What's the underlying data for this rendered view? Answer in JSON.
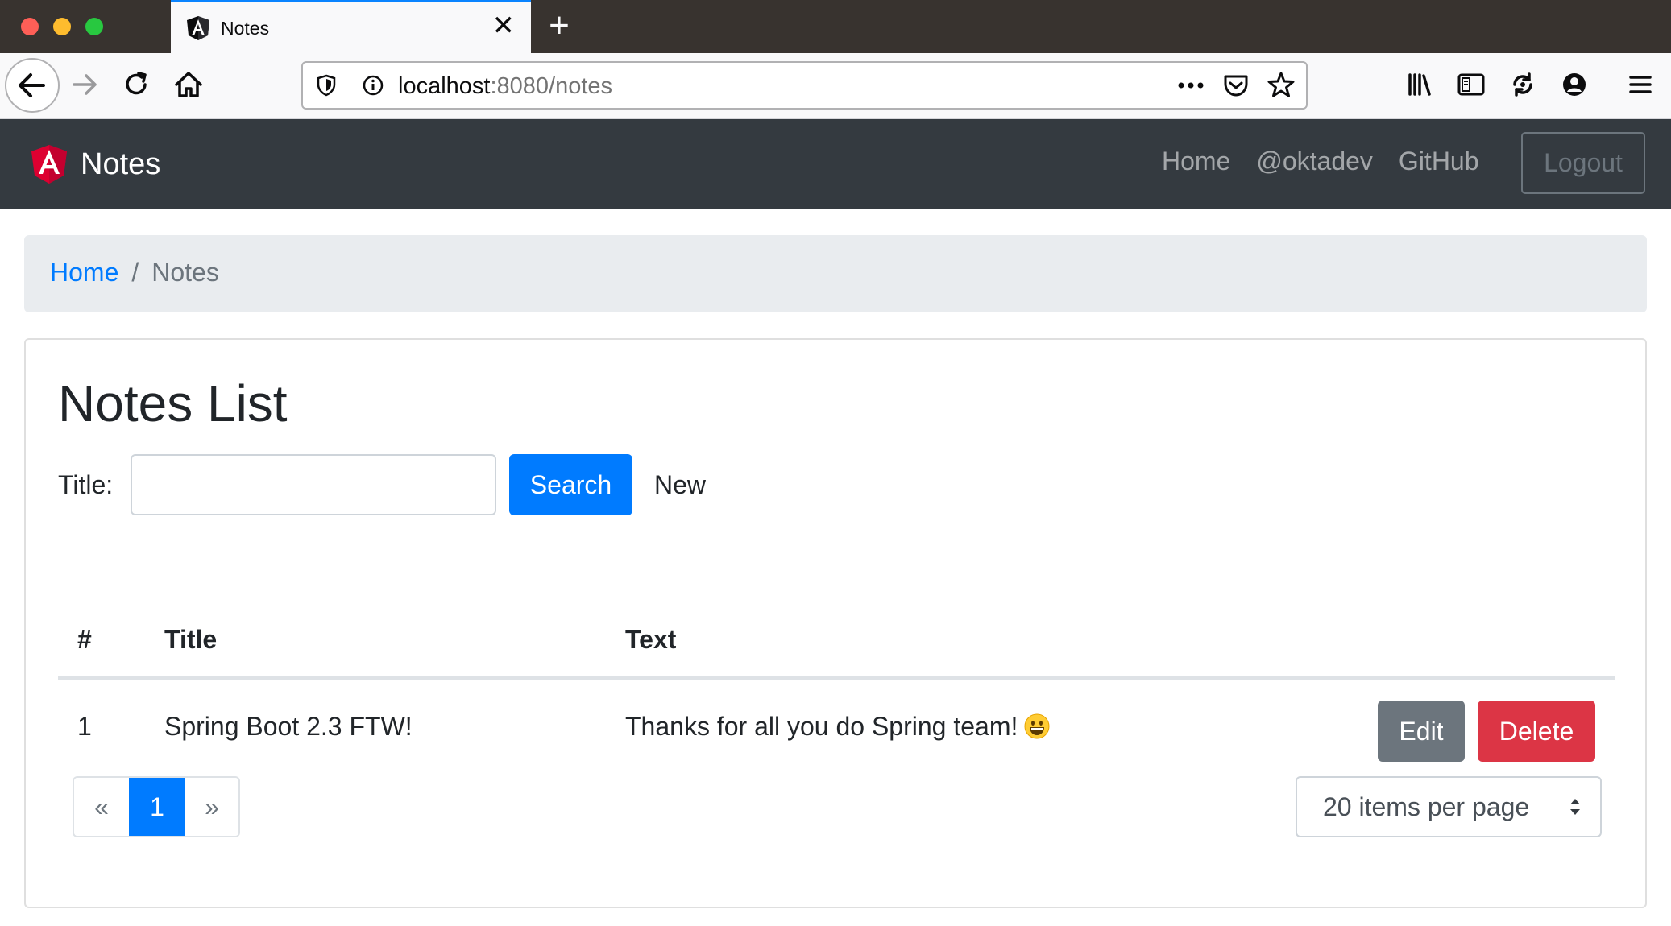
{
  "browser": {
    "tab_title": "Notes",
    "url_host": "localhost",
    "url_rest": ":8080/notes",
    "icons": [
      "back-icon",
      "forward-icon",
      "reload-icon",
      "home-icon",
      "shield-icon",
      "info-icon",
      "more-icon",
      "pocket-icon",
      "star-icon",
      "library-icon",
      "sidebar-icon",
      "sync-icon",
      "account-icon",
      "menu-icon"
    ],
    "accent": "#0a84ff"
  },
  "navbar": {
    "brand": "Notes",
    "links": [
      "Home",
      "@oktadev",
      "GitHub"
    ],
    "logout": "Logout",
    "background": "#343a40"
  },
  "breadcrumb": {
    "home": "Home",
    "separator": "/",
    "current": "Notes"
  },
  "notes": {
    "title": "Notes List",
    "search_label": "Title:",
    "search_value": "",
    "search_button": "Search",
    "new_link": "New",
    "columns": [
      "#",
      "Title",
      "Text"
    ],
    "rows": [
      {
        "id": "1",
        "title": "Spring Boot 2.3 FTW!",
        "text": "Thanks for all you do Spring team!",
        "emoji": "smiley-emoji"
      }
    ],
    "edit_button": "Edit",
    "delete_button": "Delete",
    "pagination": {
      "prev": "«",
      "current": "1",
      "next": "»"
    },
    "page_size": "20 items per page",
    "colors": {
      "primary": "#007bff",
      "secondary": "#6c757d",
      "danger": "#dc3545"
    }
  }
}
